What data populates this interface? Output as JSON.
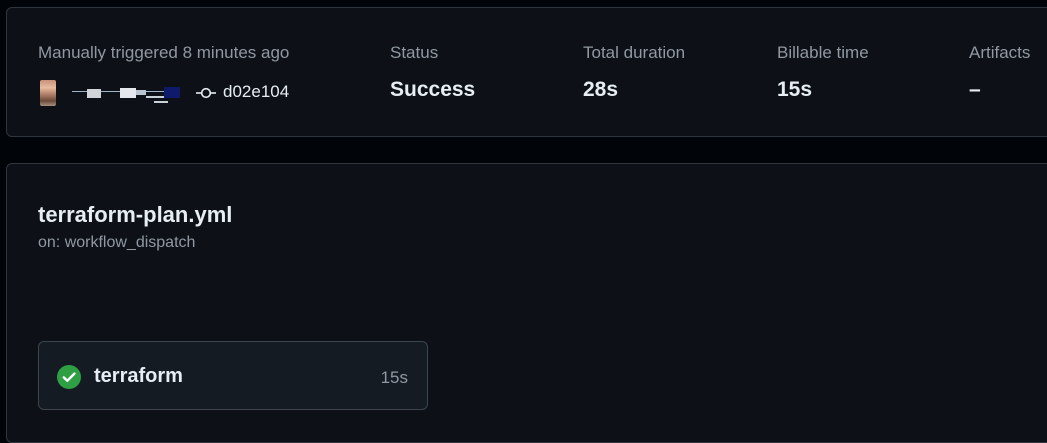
{
  "summary": {
    "trigger_label": "Manually triggered 8 minutes ago",
    "commit_sha": "d02e104",
    "status_label": "Status",
    "status_value": "Success",
    "total_duration_label": "Total duration",
    "total_duration_value": "28s",
    "billable_time_label": "Billable time",
    "billable_time_value": "15s",
    "artifacts_label": "Artifacts",
    "artifacts_value": "–"
  },
  "workflow": {
    "file_name": "terraform-plan.yml",
    "trigger": "on: workflow_dispatch"
  },
  "jobs": [
    {
      "name": "terraform",
      "duration": "15s",
      "status": "success",
      "icon": "check-circle-icon"
    }
  ],
  "colors": {
    "background": "#010409",
    "card": "#0d1117",
    "border": "#30363d",
    "success": "#2ea043",
    "muted_text": "#9198a1",
    "text": "#e6edf3"
  }
}
